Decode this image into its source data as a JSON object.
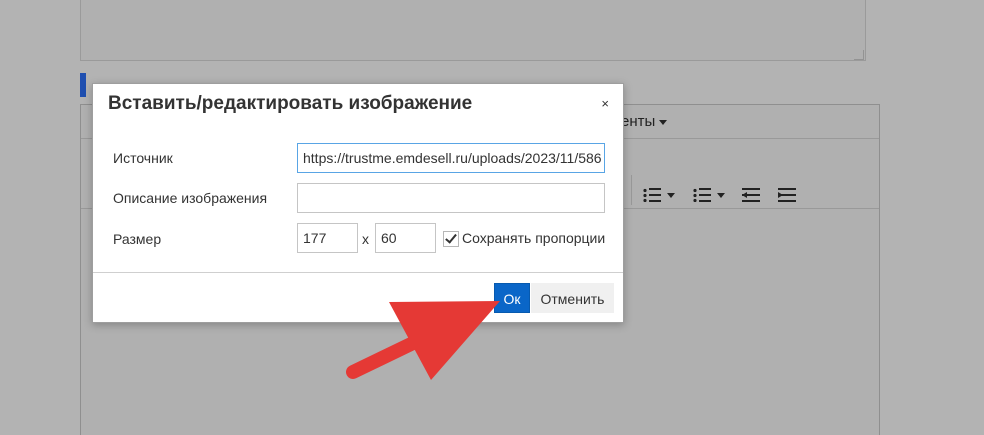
{
  "background": {
    "editor_menu_text": "енты"
  },
  "dialog": {
    "title": "Вставить/редактировать изображение",
    "close_glyph": "×",
    "source": {
      "label": "Источник",
      "value": "https://trustme.emdesell.ru/uploads/2023/11/586"
    },
    "description": {
      "label": "Описание изображения",
      "value": ""
    },
    "size": {
      "label": "Размер",
      "width": "177",
      "separator": "x",
      "height": "60",
      "keep_ratio_label": "Сохранять пропорции",
      "keep_ratio_checked": true
    },
    "ok_label": "Ок",
    "cancel_label": "Отменить"
  },
  "colors": {
    "overlay": "#b3b3b3",
    "primary_button": "#0a66c8",
    "arrow": "#e53935",
    "focus_border": "#59a5e5"
  },
  "icons": [
    "bulleted-list-icon",
    "numbered-list-icon",
    "outdent-icon",
    "indent-icon",
    "dropdown-caret-icon",
    "close-icon",
    "checkmark-icon",
    "annotation-arrow-icon"
  ]
}
